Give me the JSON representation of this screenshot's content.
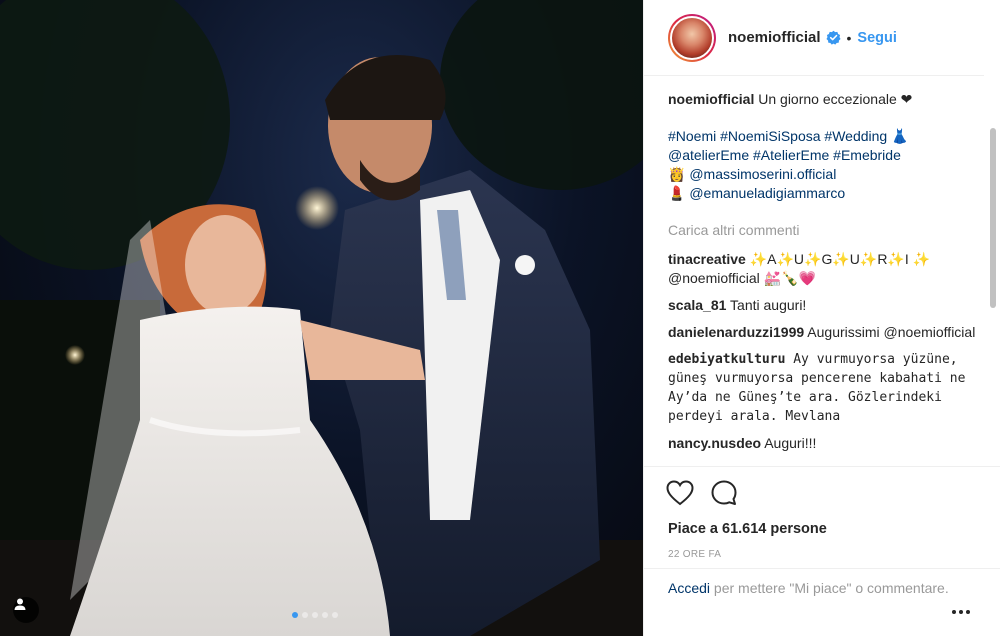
{
  "post": {
    "username": "noemiofficial",
    "separator": "•",
    "follow_label": "Segui",
    "caption_text": "Un giorno eccezionale ❤",
    "caption_line1": "#Noemi #NoemiSiSposa #Wedding 👗",
    "caption_line2": "@atelierEme #AtelierEme #Emebride",
    "caption_line3": "👸 @massimoserini.official",
    "caption_line4": "💄 @emanueladigiammarco"
  },
  "load_more_label": "Carica altri commenti",
  "comments": [
    {
      "user": "tinacreative",
      "text": "✨A✨U✨G✨U✨R✨I ✨ @noemiofficial 💒🍾💗"
    },
    {
      "user": "scala_81",
      "text": "Tanti auguri!"
    },
    {
      "user": "danielenarduzzi1999",
      "text": "Augurissimi @noemiofficial"
    },
    {
      "user": "edebiyatkulturu",
      "text": "Ay vurmuyorsa yüzüne, güneş vurmuyorsa pencerene kabahati ne Ay’da ne Güneş’te ara. Gözlerindeki perdeyi arala. Mevlana"
    },
    {
      "user": "nancy.nusdeo",
      "text": "Auguri!!!"
    }
  ],
  "likes_label": "Piace a 61.614 persone",
  "time_label": "22 ORE FA",
  "login": {
    "link": "Accedi",
    "rest": " per mettere \"Mi piace\" o commentare."
  },
  "icons": {
    "like": "heart-outline-icon",
    "comment": "speech-bubble-icon",
    "verified": "verified-badge-icon",
    "user_tag": "person-icon",
    "more": "more-options-icon"
  },
  "colors": {
    "accent": "#3897f0",
    "link": "#003569",
    "muted": "#999999",
    "text": "#262626"
  }
}
